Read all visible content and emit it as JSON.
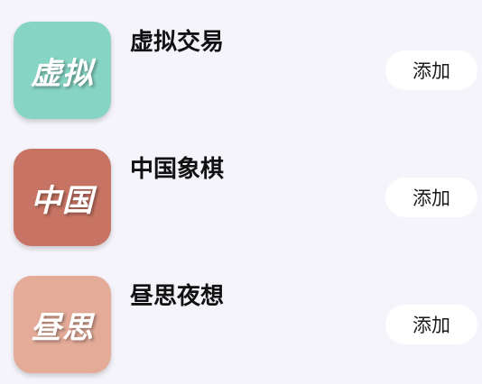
{
  "apps": [
    {
      "title": "虚拟交易",
      "icon_text": "虚拟",
      "icon_color": "#86d5c4",
      "add_label": "添加"
    },
    {
      "title": "中国象棋",
      "icon_text": "中国",
      "icon_color": "#c87464",
      "add_label": "添加"
    },
    {
      "title": "昼思夜想",
      "icon_text": "昼思",
      "icon_color": "#e4ab98",
      "add_label": "添加"
    }
  ]
}
